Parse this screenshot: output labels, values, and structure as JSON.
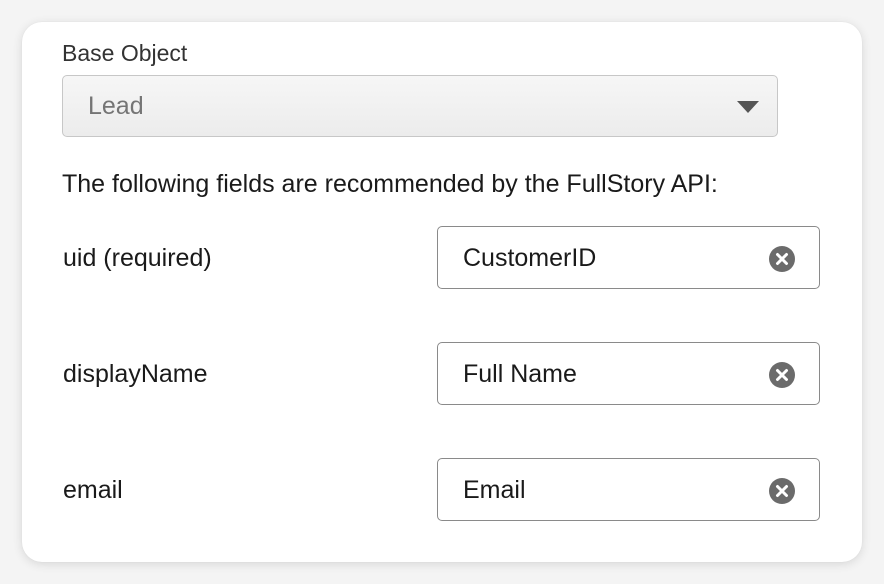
{
  "base_object": {
    "label": "Base Object",
    "selected": "Lead"
  },
  "recommendation_text": "The following fields are recommended by the FullStory API:",
  "fields": [
    {
      "label": "uid (required)",
      "value": "CustomerID"
    },
    {
      "label": "displayName",
      "value": "Full Name"
    },
    {
      "label": "email",
      "value": "Email"
    }
  ],
  "icons": {
    "dropdown": "caret-down-icon",
    "clear": "clear-circle-icon"
  },
  "colors": {
    "clear_icon": "#6b6b6b",
    "select_border": "#c7c7c7",
    "input_border": "#8a8a8a"
  }
}
